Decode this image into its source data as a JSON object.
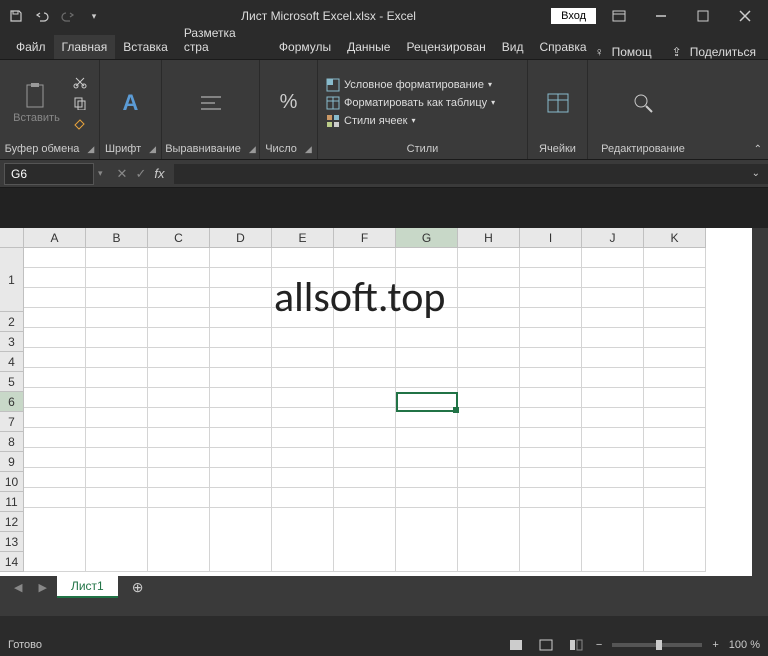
{
  "title": "Лист Microsoft Excel.xlsx  -  Excel",
  "signin": "Вход",
  "tabs": {
    "file": "Файл",
    "home": "Главная",
    "insert": "Вставка",
    "layout": "Разметка стра",
    "formulas": "Формулы",
    "data": "Данные",
    "review": "Рецензирован",
    "view": "Вид",
    "help": "Справка",
    "tellme": "Помощ",
    "share": "Поделиться"
  },
  "ribbon": {
    "clipboard": {
      "label": "Буфер обмена",
      "paste": "Вставить"
    },
    "font": {
      "label": "Шрифт"
    },
    "alignment": {
      "label": "Выравнивание"
    },
    "number": {
      "label": "Число"
    },
    "styles": {
      "label": "Стили",
      "conditional": "Условное форматирование",
      "format_table": "Форматировать как таблицу",
      "cell_styles": "Стили ячеек"
    },
    "cells": {
      "label": "Ячейки"
    },
    "editing": {
      "label": "Редактирование"
    }
  },
  "namebox": "G6",
  "columns": [
    "A",
    "B",
    "C",
    "D",
    "E",
    "F",
    "G",
    "H",
    "I",
    "J",
    "K"
  ],
  "rows": [
    "1",
    "2",
    "3",
    "4",
    "5",
    "6",
    "7",
    "8",
    "9",
    "10",
    "11",
    "12",
    "13",
    "14"
  ],
  "selected_col": "G",
  "selected_row": "6",
  "cell_content": "allsoft.top",
  "sheet": {
    "name": "Лист1"
  },
  "status": {
    "ready": "Готово",
    "zoom": "100 %"
  }
}
